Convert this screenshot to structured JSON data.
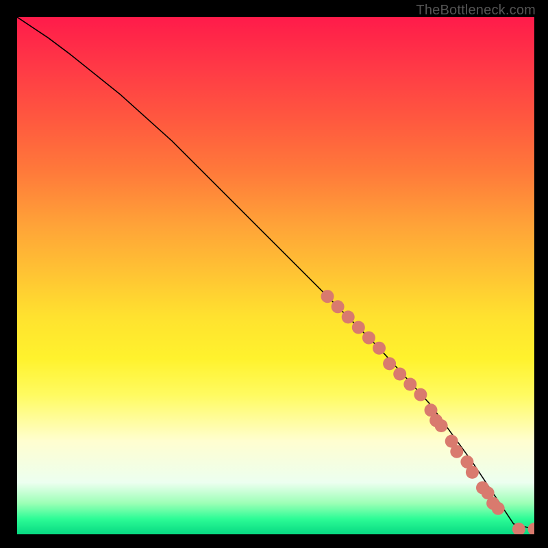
{
  "attribution": "TheBottleneck.com",
  "chart_data": {
    "type": "line",
    "title": "",
    "xlabel": "",
    "ylabel": "",
    "xlim": [
      0,
      100
    ],
    "ylim": [
      0,
      100
    ],
    "grid": false,
    "series": [
      {
        "name": "curve",
        "x": [
          0,
          3,
          6,
          10,
          15,
          20,
          30,
          40,
          50,
          60,
          70,
          80,
          88,
          92,
          96,
          100
        ],
        "y": [
          100,
          98,
          96,
          93,
          89,
          85,
          76,
          66,
          56,
          46,
          36,
          25,
          14,
          8,
          2,
          1
        ]
      }
    ],
    "points": [
      {
        "x": 60,
        "y": 46
      },
      {
        "x": 62,
        "y": 44
      },
      {
        "x": 64,
        "y": 42
      },
      {
        "x": 66,
        "y": 40
      },
      {
        "x": 68,
        "y": 38
      },
      {
        "x": 70,
        "y": 36
      },
      {
        "x": 72,
        "y": 33
      },
      {
        "x": 74,
        "y": 31
      },
      {
        "x": 76,
        "y": 29
      },
      {
        "x": 78,
        "y": 27
      },
      {
        "x": 80,
        "y": 24
      },
      {
        "x": 81,
        "y": 22
      },
      {
        "x": 82,
        "y": 21
      },
      {
        "x": 84,
        "y": 18
      },
      {
        "x": 85,
        "y": 16
      },
      {
        "x": 87,
        "y": 14
      },
      {
        "x": 88,
        "y": 12
      },
      {
        "x": 90,
        "y": 9
      },
      {
        "x": 91,
        "y": 8
      },
      {
        "x": 92,
        "y": 6
      },
      {
        "x": 93,
        "y": 5
      },
      {
        "x": 97,
        "y": 1
      },
      {
        "x": 100,
        "y": 1
      }
    ],
    "colors": {
      "curve": "#000000",
      "point_fill": "#d97a6e"
    }
  }
}
